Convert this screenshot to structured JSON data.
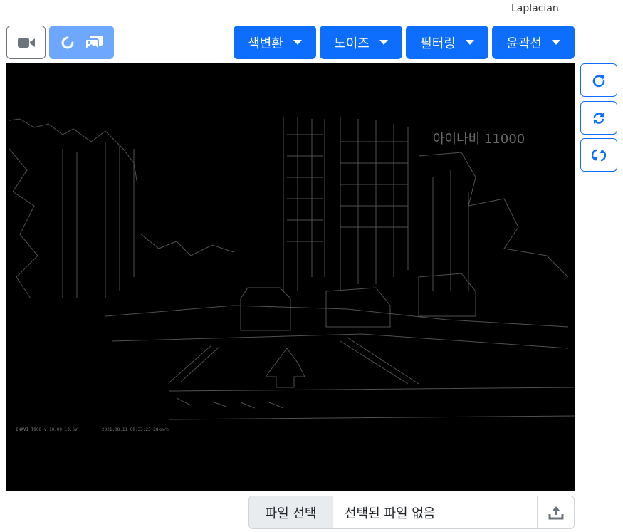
{
  "header": {
    "filter_name": "Laplacian"
  },
  "toolbar": {
    "camera_icon": "video-camera-icon",
    "gallery_icons": [
      "rotate-icon",
      "images-icon"
    ],
    "menus": [
      {
        "label": "색변환"
      },
      {
        "label": "노이즈"
      },
      {
        "label": "필터링"
      },
      {
        "label": "윤곽선"
      }
    ],
    "accent_color": "#0d6efd"
  },
  "viewer": {
    "overlay_text": "아이나비 11000",
    "osd_left": "INAVI T900  v.10.00  13.5V",
    "osd_right": "2021.08.11 09:33:23  28km/h"
  },
  "side_buttons": [
    "rotate-cw-icon",
    "sync-icon",
    "refresh-icon"
  ],
  "file": {
    "choose_label": "파일 선택",
    "status": "선택된 파일 없음",
    "upload_icon": "upload-icon"
  }
}
